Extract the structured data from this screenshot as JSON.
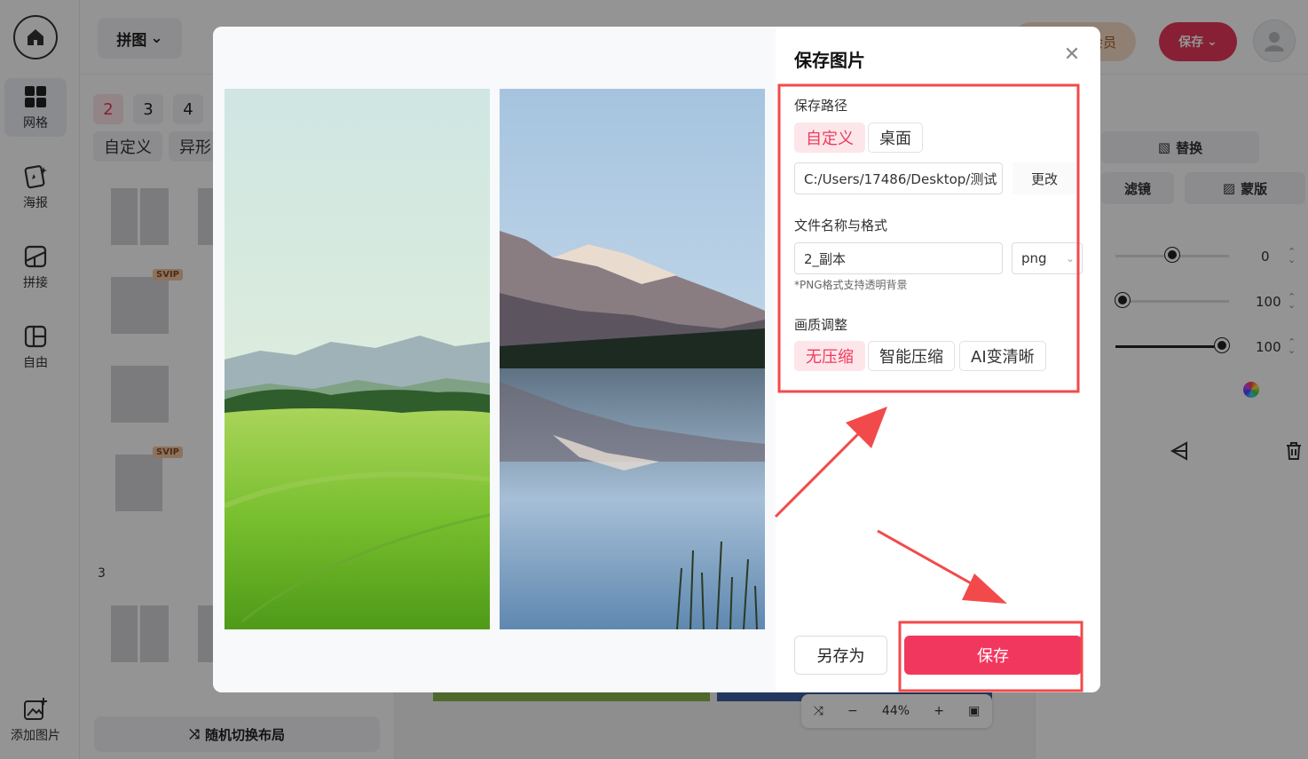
{
  "sidebar": {
    "items": [
      {
        "label": "网格",
        "icon": "grid-icon"
      },
      {
        "label": "海报",
        "icon": "poster-icon"
      },
      {
        "label": "拼接",
        "icon": "stitch-icon"
      },
      {
        "label": "自由",
        "icon": "free-layout-icon"
      }
    ],
    "add_image": "添加图片"
  },
  "topbar": {
    "mode": "拼图",
    "vip": "会员",
    "save": "保存"
  },
  "layout_panel": {
    "counts": [
      "2",
      "3",
      "4"
    ],
    "categories": [
      "自定义",
      "异形"
    ],
    "svip_badge": "SVIP",
    "section_label": "3",
    "random_layout": "随机切换布局"
  },
  "right_panel": {
    "replace": "替换",
    "filter": "滤镜",
    "mask": "蒙版",
    "slider_values": [
      "0",
      "100",
      "100"
    ]
  },
  "zoom": {
    "level": "44%"
  },
  "dialog": {
    "title": "保存图片",
    "save_path_label": "保存路径",
    "path_options": [
      "自定义",
      "桌面"
    ],
    "path_value": "C:/Users/17486/Desktop/测试",
    "change": "更改",
    "file_label": "文件名称与格式",
    "filename": "2_副本",
    "format": "png",
    "hint": "*PNG格式支持透明背景",
    "quality_label": "画质调整",
    "quality_options": [
      "无压缩",
      "智能压缩",
      "AI变清晰"
    ],
    "save_as": "另存为",
    "save": "保存"
  },
  "colors": {
    "accent": "#f2375f",
    "annotation": "#f24a4a"
  }
}
